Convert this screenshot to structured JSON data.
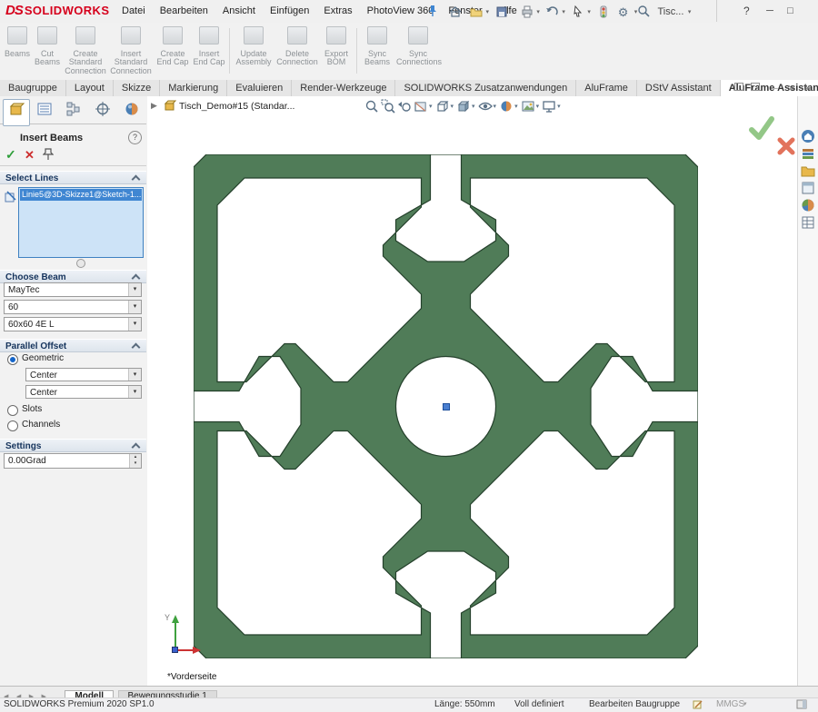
{
  "window": {
    "logo_ds": "DS",
    "logo_text": "SOLIDWORKS",
    "controls": {
      "minimize": "─",
      "maximize": "□",
      "close": "✕"
    }
  },
  "menubar": {
    "items": [
      "Datei",
      "Bearbeiten",
      "Ansicht",
      "Einfügen",
      "Extras",
      "PhotoView 360",
      "Fenster",
      "Hilfe"
    ],
    "search_value": "Tisc...",
    "help_label": "?"
  },
  "ribbon": {
    "buttons": [
      "Beams",
      "Cut Beams",
      "Create Standard Connection",
      "Insert Standard Connection",
      "Create End Cap",
      "Insert End Cap",
      "Update Assembly",
      "Delete Connection",
      "Export BOM",
      "Sync Beams",
      "Sync Connections"
    ]
  },
  "command_tabs": {
    "tabs": [
      "Baugruppe",
      "Layout",
      "Skizze",
      "Markierung",
      "Evaluieren",
      "Render-Werkzeuge",
      "SOLIDWORKS Zusatzanwendungen",
      "AluFrame",
      "DStV Assistant",
      "AluFrame Assistant"
    ],
    "active": "AluFrame Assistant"
  },
  "property_panel": {
    "title": "Insert Beams",
    "help": "?",
    "confirm": "✓",
    "cancel": "✕",
    "select_lines": {
      "header": "Select Lines",
      "selection": "Linie5@3D-Skizze1@Sketch-1..."
    },
    "choose_beam": {
      "header": "Choose Beam",
      "vendor": "MayTec",
      "series": "60",
      "profile": "60x60 4E L"
    },
    "parallel_offset": {
      "header": "Parallel Offset",
      "geometric": "Geometric",
      "offset1": "Center",
      "offset2": "Center",
      "slots": "Slots",
      "channels": "Channels"
    },
    "settings": {
      "header": "Settings",
      "angle": "0.00Grad"
    }
  },
  "viewport": {
    "document_title": "Tisch_Demo#15 (Standar...",
    "view_label": "*Vorderseite",
    "axis_y_label": "Y"
  },
  "bottom_bar": {
    "nav": [
      "◀",
      "◀",
      "▶",
      "▶"
    ],
    "tabs": [
      "Modell",
      "Bewegungsstudie 1"
    ],
    "active": "Modell"
  },
  "statusbar": {
    "app_version": "SOLIDWORKS Premium 2020 SP1.0",
    "length": "Länge: 550mm",
    "definition": "Voll definiert",
    "mode": "Bearbeiten Baugruppe",
    "units": "MMGS"
  },
  "colors": {
    "profile_fill": "#507c58",
    "profile_edge": "#24402b",
    "selection_blue": "#3f86d2",
    "brand_red": "#d6001c"
  }
}
